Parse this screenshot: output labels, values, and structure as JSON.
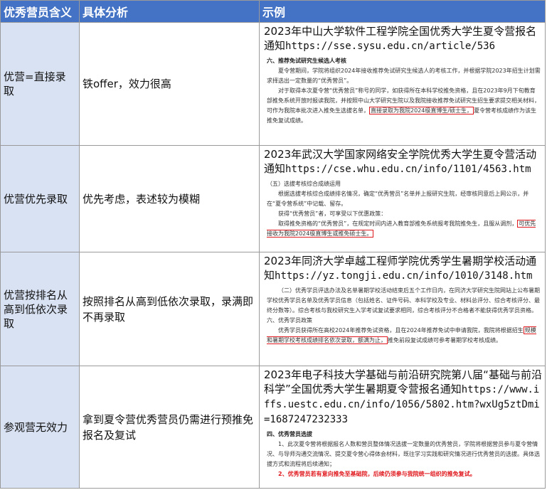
{
  "header": {
    "col1": "优秀营员含义",
    "col2": "具体分析",
    "col3": "示例"
  },
  "rows": [
    {
      "meaning": "优营=直接录取",
      "analysis": "铁offer，效力很高",
      "example_title": "2023年中山大学软件工程学院全国优秀大学生夏令营报名通知",
      "example_url": "https://sse.sysu.edu.cn/article/536",
      "snippet": {
        "heading": "六、推荐免试研究生候选人考核",
        "p1": "夏令营期间，学院将组织2024年接收推荐免试研究生候选人的考核工作，并根据学院2023年招生计划需求择选出一定数量的“优秀营员”。",
        "p2_a": "对于取得本次夏令营“优秀营员”称号的同学，如获得所在本科学校推免资格，且在2023年9月下旬教育部推免系统开放时报读我院，并按照中山大学研究生院以及我院接收推荐免试研究生招生要求提交相关材料，可作为我院本批次进入推免生选拔名单，",
        "p2_hl": "直接录取为我院2024级直博生/硕士生，",
        "p2_b": "夏令营考核成绩作为该生推免复试成绩。"
      }
    },
    {
      "meaning": "优营优先录取",
      "analysis": "优先考虑，表述较为模糊",
      "example_title": "2023年武汉大学国家网络安全学院优秀大学生夏令营活动通知",
      "example_url": "https://cse.whu.edu.cn/info/1101/4563.htm",
      "snippet": {
        "heading": "（五）选拔考核综合成绩运用",
        "p1": "根据选拔考核综合成绩排名情况，确定“优秀营员”名单并上报研究生院，经审核同意后上网公示，并在“夏令营系统”中记载、留存。",
        "p2": "获得“优秀营员”者，可享受以下优惠政策：",
        "p3_a": "取得推免资格的“优秀营员”，在规定时间内进入教育部推免系统报考我院推免生，且服从调剂，",
        "p3_hl": "可优先接收为我院2024级直博生或推免硕士生。"
      }
    },
    {
      "meaning": "优营按排名从高到低依次录取",
      "analysis": "按照排名从高到低依次录取，录满即不再录取",
      "example_title": "2023年同济大学卓越工程师学院优秀学生暑期学校活动通知",
      "example_url": "https://yz.tongji.edu.cn/info/1010/3148.htm",
      "snippet": {
        "p1": "（二）优秀学员评选办法及名单暑期学校活动结束后五个工作日内，在同济大学研究生院网站上公布暑期学校优秀学员名单及优秀学员信息（包括姓名、证件号码、本科学校及专业、材料总评分、综合考核评分、最终分数等）。综合考核与我校研究生入学考试复试要求相同，综合考核评分不合格者不能获得优秀学员资格。六、优秀学员政策",
        "p2_a": "优秀学员获得所在高校2024年推荐免试资格，且在2024年推荐免试中申请我院，我院将根据招生",
        "p2_hl": "规模和暑期学校考核成绩排名依次录取，额满为止，",
        "p2_b": "推免前段复试成绩可参考暑期学校考核成绩。"
      }
    },
    {
      "meaning": "参观营无效力",
      "analysis": "拿到夏令营优秀营员仍需进行预推免报名及复试",
      "example_title": "2023年电子科技大学基础与前沿研究院第八届“基础与前沿科学”全国优秀大学生暑期夏令营报名通知",
      "example_url": "https://www.iffs.uestc.edu.cn/info/1056/5802.htm?wxUg5ztDmi=1687247232333",
      "snippet": {
        "heading": "四、优秀营员选拔",
        "p1": "1、此次夏令营将根据报名人数和营员整体情况选拔一定数量的优秀营员，学院将根据营员参与夏令营情况、与导师沟通交流情况、提交夏令营心得体会材料，既往学习实践和研究情况进行优秀营员的选拔。具体选拔方式和流程将后续通知；",
        "p2": "2、优秀营员若有意向推免至基础院，后续仍须参与我院统一组织的推免复试。"
      }
    }
  ]
}
